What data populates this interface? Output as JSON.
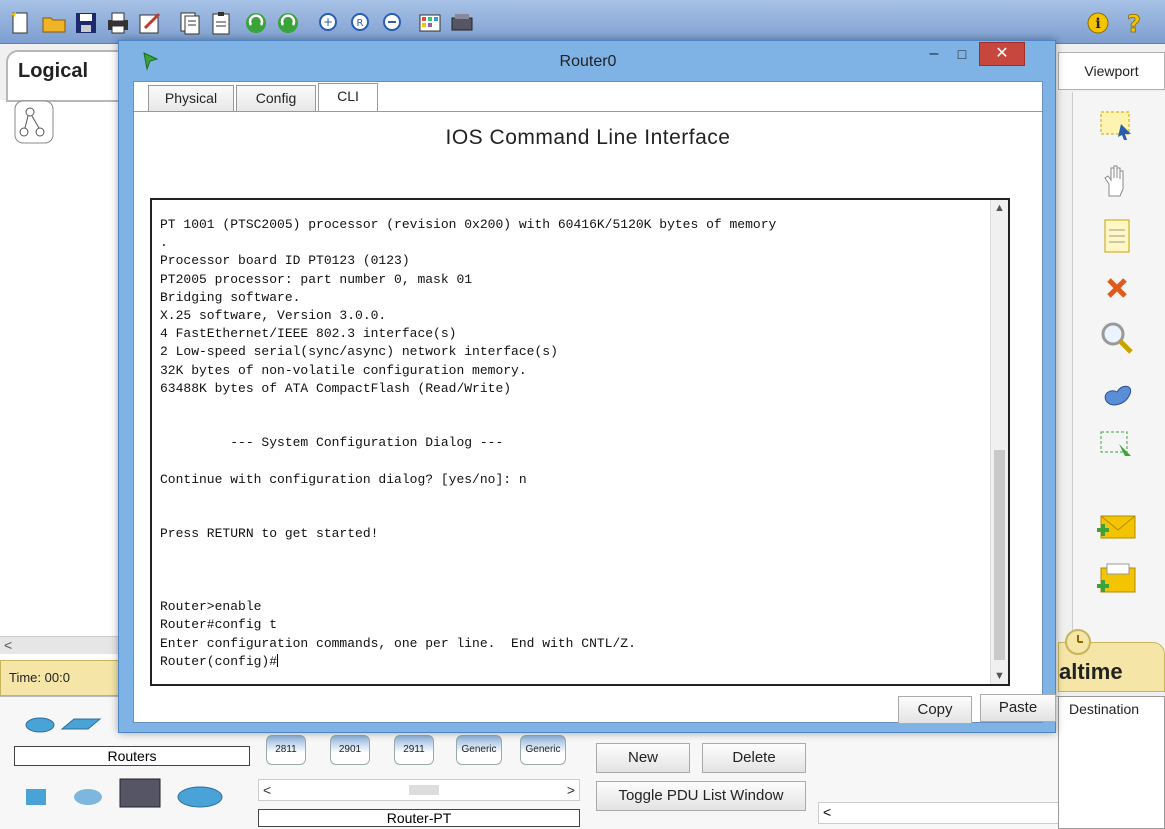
{
  "toolbar": {
    "icons": [
      "new-file-icon",
      "open-folder-icon",
      "save-icon",
      "print-icon",
      "edit-icon",
      "copy-icon",
      "paste-icon",
      "undo-icon",
      "redo-icon",
      "zoom-in-icon",
      "zoom-reset-icon",
      "zoom-out-icon",
      "palette-icon",
      "custom-device-icon",
      "info-icon",
      "help-icon"
    ],
    "help_glyph": "?",
    "info_glyph": "i"
  },
  "workspace": {
    "tab_label": "Logical",
    "scroll_left_glyph": "<",
    "time_label": "Time: 00:0"
  },
  "right_panel": {
    "viewport_label": "Viewport",
    "realtime_label": "altime",
    "destination_header": "Destination"
  },
  "dialog": {
    "title": "Router0",
    "minimize_glyph": "–",
    "maximize_glyph": "□",
    "close_glyph": "✕",
    "tabs": [
      {
        "label": "Physical",
        "active": false
      },
      {
        "label": "Config",
        "active": false
      },
      {
        "label": "CLI",
        "active": true
      }
    ],
    "heading": "IOS Command Line Interface",
    "terminal_lines": [
      "PT 1001 (PTSC2005) processor (revision 0x200) with 60416K/5120K bytes of memory",
      ".",
      "Processor board ID PT0123 (0123)",
      "PT2005 processor: part number 0, mask 01",
      "Bridging software.",
      "X.25 software, Version 3.0.0.",
      "4 FastEthernet/IEEE 802.3 interface(s)",
      "2 Low-speed serial(sync/async) network interface(s)",
      "32K bytes of non-volatile configuration memory.",
      "63488K bytes of ATA CompactFlash (Read/Write)",
      "",
      "",
      "         --- System Configuration Dialog ---",
      "",
      "Continue with configuration dialog? [yes/no]: n",
      "",
      "",
      "Press RETURN to get started!",
      "",
      "",
      "",
      "Router>enable",
      "Router#config t",
      "Enter configuration commands, one per line.  End with CNTL/Z."
    ],
    "prompt": "Router(config)#",
    "copy_label": "Copy",
    "paste_label": "Paste"
  },
  "bottom": {
    "category_label": "Routers",
    "models": [
      "2811",
      "2901",
      "2911",
      "Generic",
      "Generic"
    ],
    "selected_model_label": "Router-PT",
    "new_label": "New",
    "delete_label": "Delete",
    "toggle_pdu_label": "Toggle PDU List Window",
    "scroll_left": "<",
    "scroll_right": ">"
  },
  "colors": {
    "dialog_frame": "#7fb3e6",
    "close_button": "#c7463d",
    "toolbar": "#8fb0dd",
    "time_bar": "#f5e6a8"
  }
}
